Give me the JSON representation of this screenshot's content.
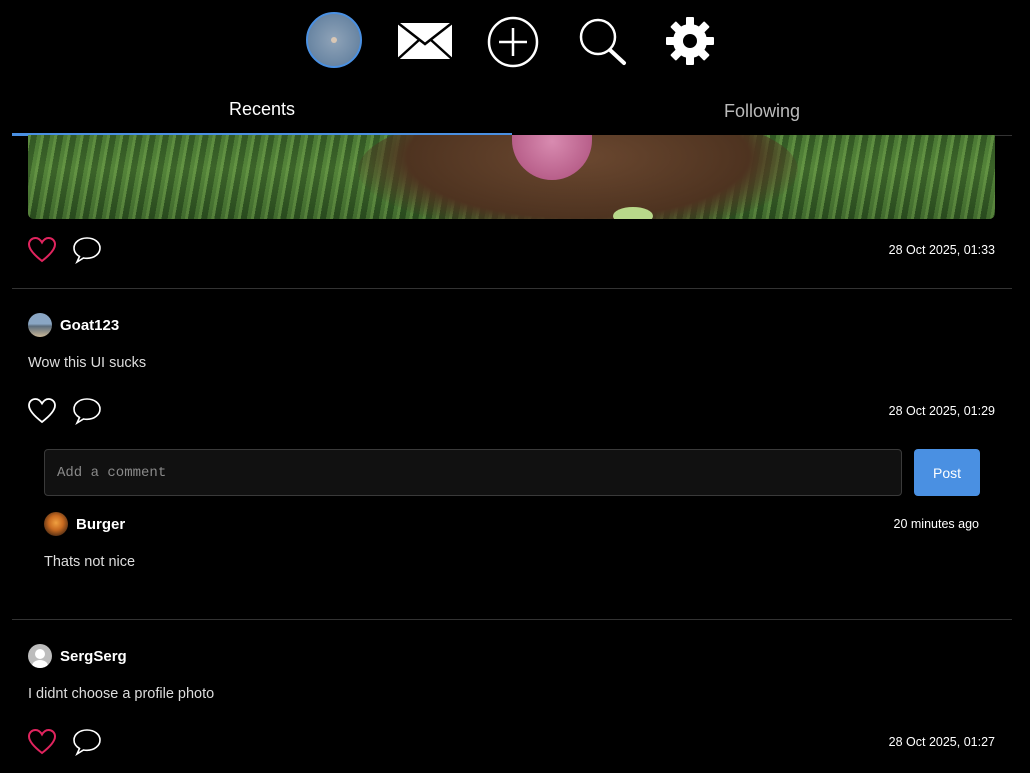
{
  "nav": {
    "icons": [
      "profile-avatar",
      "mail-icon",
      "plus-circle-icon",
      "search-icon",
      "gear-icon"
    ]
  },
  "tabs": {
    "recents": "Recents",
    "following": "Following",
    "active": "Recents"
  },
  "posts": [
    {
      "has_image": true,
      "liked": true,
      "timestamp": "28 Oct 2025, 01:33"
    },
    {
      "author": "Goat123",
      "text": "Wow this UI sucks",
      "liked": false,
      "timestamp": "28 Oct 2025, 01:29",
      "comment_box": {
        "placeholder": "Add a comment",
        "value": "",
        "post_label": "Post"
      },
      "comments": [
        {
          "author": "Burger",
          "text": "Thats not nice",
          "time": "20 minutes ago"
        }
      ]
    },
    {
      "author": "SergSerg",
      "text": "I didnt choose a profile photo",
      "liked": true,
      "timestamp": "28 Oct 2025, 01:27"
    }
  ],
  "colors": {
    "accent": "#4a90e2",
    "like_active": "#e0245e",
    "background": "#000000"
  }
}
